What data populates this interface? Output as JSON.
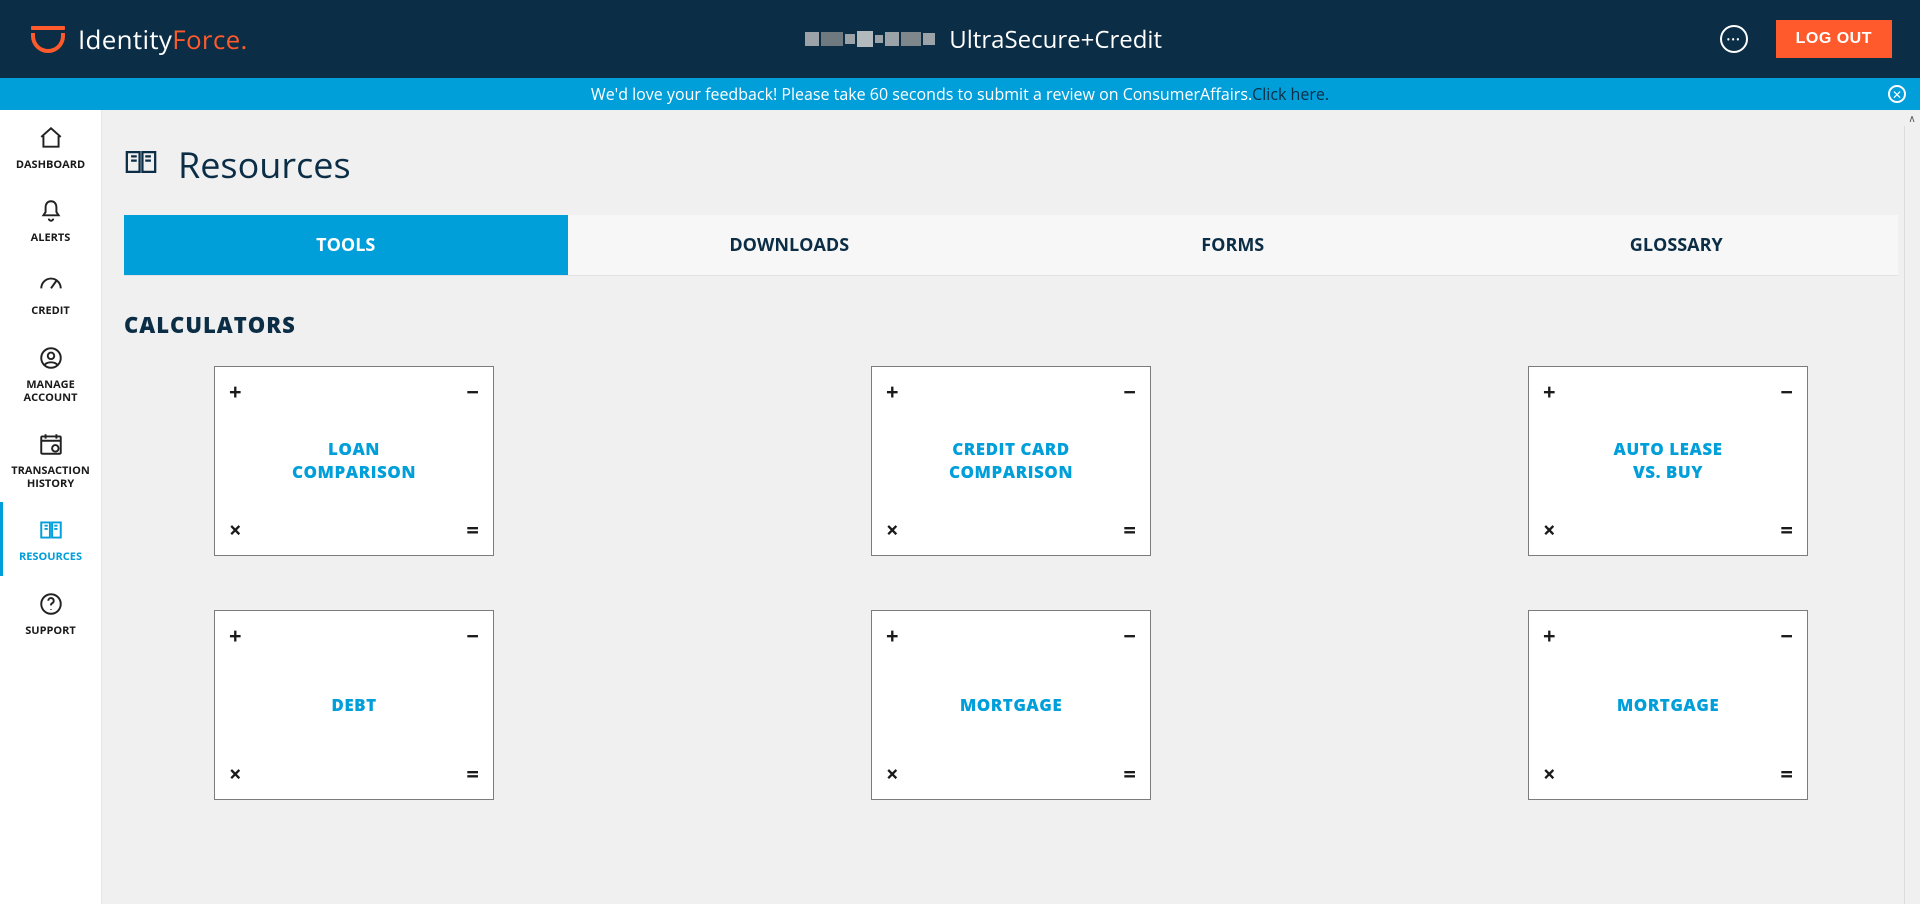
{
  "header": {
    "brand_primary": "Identity",
    "brand_secondary": "Force",
    "plan_label": "UltraSecure+Credit",
    "logout_label": "LOG OUT"
  },
  "feedback": {
    "text": "We'd love your feedback! Please take 60 seconds to submit a review on ConsumerAffairs. ",
    "link_text": "Click here."
  },
  "sidebar": {
    "items": [
      {
        "label": "DASHBOARD"
      },
      {
        "label": "ALERTS"
      },
      {
        "label": "CREDIT"
      },
      {
        "label": "MANAGE\nACCOUNT"
      },
      {
        "label": "TRANSACTION\nHISTORY"
      },
      {
        "label": "RESOURCES"
      },
      {
        "label": "SUPPORT"
      }
    ]
  },
  "page": {
    "title": "Resources",
    "tabs": [
      {
        "label": "TOOLS"
      },
      {
        "label": "DOWNLOADS"
      },
      {
        "label": "FORMS"
      },
      {
        "label": "GLOSSARY"
      }
    ],
    "section_title": "CALCULATORS",
    "calculators": [
      {
        "title": "LOAN\nCOMPARISON"
      },
      {
        "title": "CREDIT CARD\nCOMPARISON"
      },
      {
        "title": "AUTO LEASE\nVS. BUY"
      },
      {
        "title": "DEBT"
      },
      {
        "title": "MORTGAGE"
      },
      {
        "title": "MORTGAGE"
      }
    ]
  },
  "glyphs": {
    "plus": "+",
    "minus": "−",
    "times": "×",
    "equals": "="
  }
}
